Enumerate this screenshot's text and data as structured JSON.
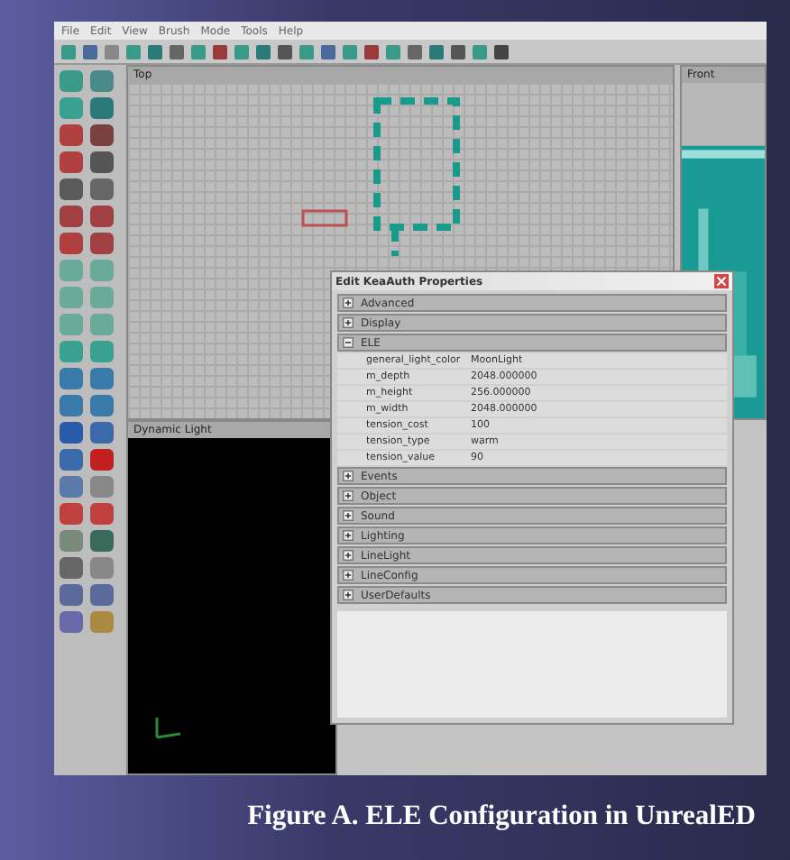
{
  "menu_bar": [
    "File",
    "Edit",
    "View",
    "Brush",
    "Mode",
    "Tools",
    "Help"
  ],
  "viewports": [
    {
      "title": "Top",
      "kind": "grid"
    },
    {
      "title": "Front",
      "kind": "render"
    },
    {
      "title": "Dynamic Light",
      "kind": "dark"
    }
  ],
  "properties_window": {
    "title": "Edit KeaAuth Properties",
    "categories": [
      {
        "label": "Advanced",
        "expanded": false
      },
      {
        "label": "Display",
        "expanded": false
      },
      {
        "label": "ELE",
        "expanded": true,
        "children": [
          {
            "name": "general_light_color",
            "value": "MoonLight"
          },
          {
            "name": "m_depth",
            "value": "2048.000000"
          },
          {
            "name": "m_height",
            "value": "256.000000"
          },
          {
            "name": "m_width",
            "value": "2048.000000"
          },
          {
            "name": "tension_cost",
            "value": "100"
          },
          {
            "name": "tension_type",
            "value": "warm"
          },
          {
            "name": "tension_value",
            "value": "90"
          }
        ]
      },
      {
        "label": "Events",
        "expanded": false
      },
      {
        "label": "Object",
        "expanded": false
      },
      {
        "label": "Sound",
        "expanded": false
      },
      {
        "label": "Lighting",
        "expanded": false
      },
      {
        "label": "LineLight",
        "expanded": false
      },
      {
        "label": "LineConfig",
        "expanded": false
      },
      {
        "label": "UserDefaults",
        "expanded": false
      }
    ]
  },
  "caption": "Figure A. ELE Configuration in UnrealED"
}
